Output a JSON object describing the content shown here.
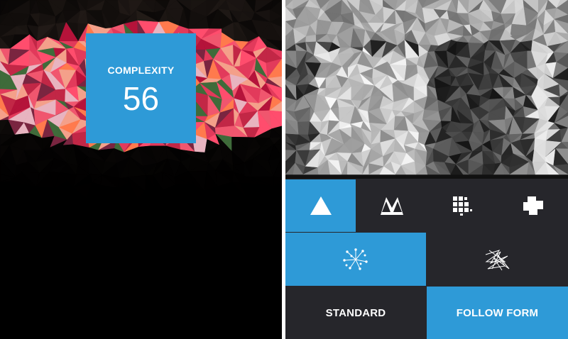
{
  "complexity": {
    "label": "COMPLEXITY",
    "value": "56"
  },
  "modes": [
    {
      "icon": "triangle-icon",
      "active": true
    },
    {
      "icon": "mountain-icon",
      "active": false
    },
    {
      "icon": "pixel-icon",
      "active": false
    },
    {
      "icon": "blocks-icon",
      "active": false
    }
  ],
  "styles": [
    {
      "icon": "scatter-icon",
      "active": true
    },
    {
      "icon": "lines-icon",
      "active": false
    }
  ],
  "buttons": {
    "standard": "STANDARD",
    "follow_form": "FOLLOW FORM",
    "follow_form_active": true
  },
  "colors": {
    "accent": "#2e9ad7",
    "panel": "#26262b",
    "divider": "#ffffff"
  }
}
